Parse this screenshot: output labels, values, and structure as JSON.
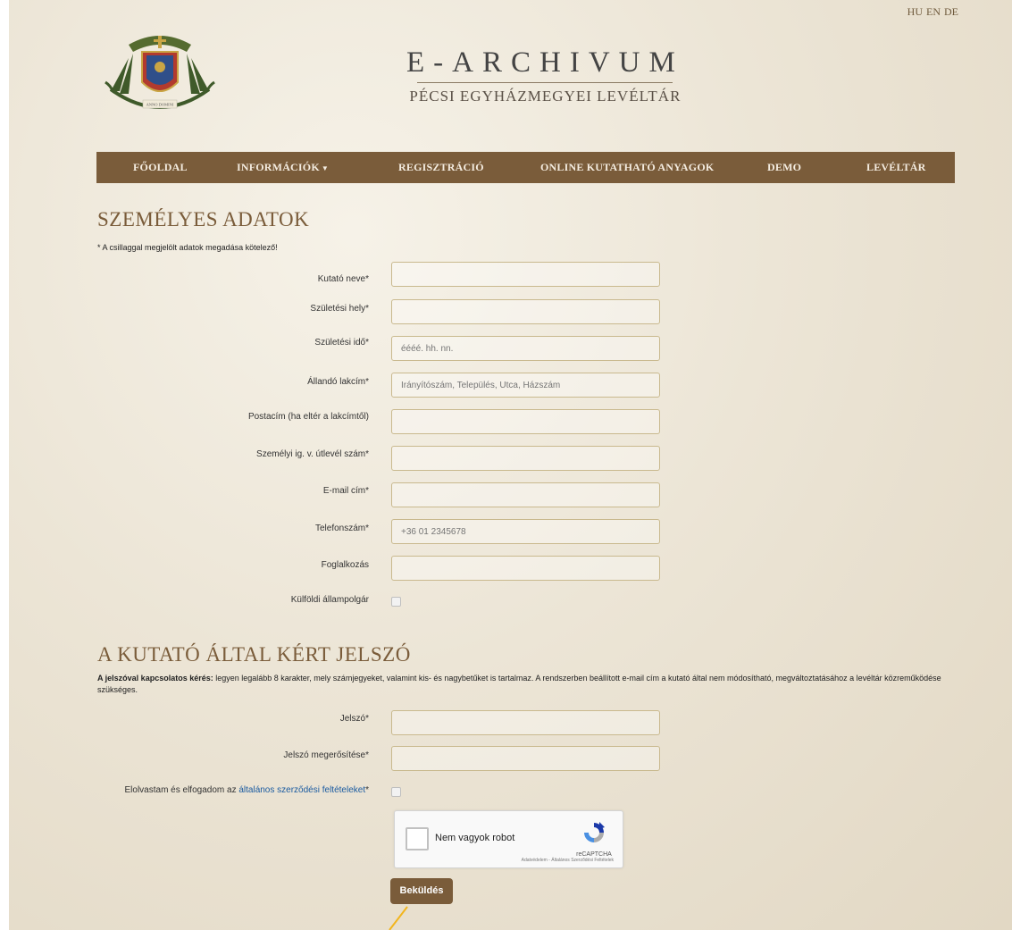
{
  "lang": [
    "HU",
    "EN",
    "DE"
  ],
  "title": {
    "main": "E-ARCHIVUM",
    "sub": "PÉCSI EGYHÁZMEGYEI LEVÉLTÁR"
  },
  "logo": {
    "motto": "ANNO DOMINI"
  },
  "nav": [
    {
      "label": "FŐOLDAL"
    },
    {
      "label": "INFORMÁCIÓK",
      "has_dropdown": true
    },
    {
      "label": "REGISZTRÁCIÓ"
    },
    {
      "label": "ONLINE KUTATHATÓ ANYAGOK"
    },
    {
      "label": "DEMO"
    },
    {
      "label": "LEVÉLTÁR"
    }
  ],
  "personal": {
    "heading": "SZEMÉLYES ADATOK",
    "note": "* A csillaggal megjelölt adatok megadása kötelező!",
    "fields": [
      {
        "label": "Kutató neve*",
        "placeholder": ""
      },
      {
        "label": "Születési hely*",
        "placeholder": ""
      },
      {
        "label": "Születési idő*",
        "placeholder": "éééé. hh. nn."
      },
      {
        "label": "Állandó lakcím*",
        "placeholder": "Irányítószám, Település, Utca, Házszám"
      },
      {
        "label": "Postacím (ha eltér a lakcímtől)",
        "placeholder": ""
      },
      {
        "label": "Személyi ig. v. útlevél szám*",
        "placeholder": ""
      },
      {
        "label": "E-mail cím*",
        "placeholder": ""
      },
      {
        "label": "Telefonszám*",
        "placeholder": "+36 01 2345678"
      },
      {
        "label": "Foglalkozás",
        "placeholder": ""
      }
    ],
    "foreign_label": "Külföldi állampolgár"
  },
  "password": {
    "heading": "A KUTATÓ ÁLTAL KÉRT JELSZÓ",
    "note_bold": "A jelszóval kapcsolatos kérés:",
    "note_text": " legyen legalább 8 karakter, mely számjegyeket, valamint kis- és nagybetűket is tartalmaz. A rendszerben beállított e-mail cím a kutató által nem módosítható, megváltoztatásához a levéltár közreműködése szükséges.",
    "fields": [
      {
        "label": "Jelszó*",
        "placeholder": ""
      },
      {
        "label": "Jelszó megerősítése*",
        "placeholder": ""
      }
    ],
    "terms_prefix": "Elolvastam és elfogadom az ",
    "terms_link": "általános szerződési feltételeket",
    "terms_suffix": "*"
  },
  "captcha": {
    "label": "Nem vagyok robot",
    "brand": "reCAPTCHA",
    "links": "Adatvédelem - Általános Szerződési Feltételek"
  },
  "submit_label": "Beküldés",
  "colors": {
    "brown": "#7a5c3a",
    "link": "#1a5aa0"
  }
}
